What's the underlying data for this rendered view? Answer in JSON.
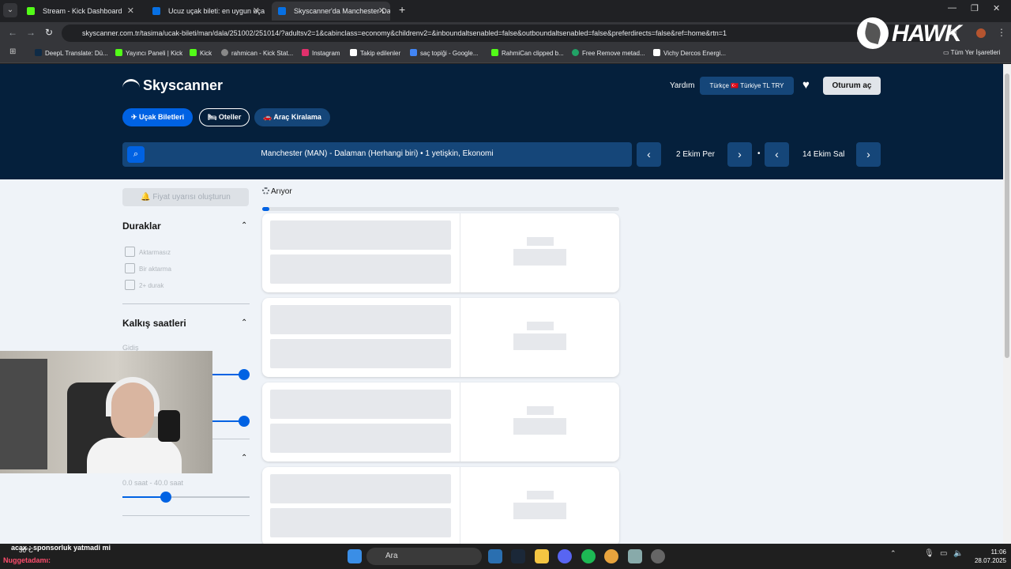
{
  "browser": {
    "tabs": [
      {
        "title": "Stream - Kick Dashboard",
        "icon": "kick-icon",
        "color": "#53fc18"
      },
      {
        "title": "Ucuz uçak bileti: en uygun uçak",
        "icon": "skyscanner-icon",
        "color": "#0770e3"
      },
      {
        "title": "Skyscanner'da Manchester-Dal",
        "icon": "skyscanner-icon",
        "color": "#0770e3"
      }
    ],
    "url": "skyscanner.com.tr/tasima/ucak-bileti/man/dala/251002/251014/?adultsv2=1&cabinclass=economy&childrenv2=&inboundaltsenabled=false&outboundaltsenabled=false&preferdirects=false&ref=home&rtn=1",
    "bookmarks": [
      {
        "label": "DeepL Translate: Dü...",
        "color": "#0f2b46"
      },
      {
        "label": "Yayıncı Paneli | Kick",
        "color": "#53fc18"
      },
      {
        "label": "Kick",
        "color": "#53fc18"
      },
      {
        "label": "rahmican - Kick Stat...",
        "color": "#888888"
      },
      {
        "label": "Instagram",
        "color": "#e1306c"
      },
      {
        "label": "Takip edilenler",
        "color": "#ffffff"
      },
      {
        "label": "saç topiği - Google...",
        "color": "#4285f4"
      },
      {
        "label": "RahmiCan clipped b...",
        "color": "#53fc18"
      },
      {
        "label": "Free Remove metad...",
        "color": "#21a366"
      },
      {
        "label": "Vichy Dercos Energi...",
        "color": "#ffffff"
      }
    ],
    "all_bookmarks": "Tüm Yer İşaretleri",
    "overlay_logo": "HAWK"
  },
  "header": {
    "logo": "Skyscanner",
    "help": "Yardım",
    "locale": "Türkçe  🇹🇷 Türkiye  TL TRY",
    "signin": "Oturum aç",
    "tabs": [
      {
        "label": "✈ Uçak Biletleri",
        "selected": true
      },
      {
        "label": "🛏 Oteller",
        "selected": false
      },
      {
        "label": "🚗 Araç Kiralama",
        "selected": false
      }
    ],
    "search_query": "Manchester (MAN) - Dalaman (Herhangi biri)  •  1 yetişkin, Ekonomi",
    "depart_date": "2 Ekim Per",
    "return_date": "14 Ekim Sal"
  },
  "main": {
    "price_alert": "🔔 Fiyat uyarısı oluşturun",
    "searching": "Arıyor",
    "progress": 0.02
  },
  "filters": {
    "stops_title": "Duraklar",
    "stops": [
      "Aktarmasız",
      "Bir aktarma",
      "2+ durak"
    ],
    "times_title": "Kalkış saatleri",
    "outbound_label": "Gidiş",
    "duration_label": "0.0 saat - 40.0 saat"
  },
  "stream": {
    "weather": "30°C",
    "chat_line": "acax : sponsorluk yatmadi mi",
    "chat_user": "Nuggetadamı:"
  },
  "taskbar": {
    "search": "Ara",
    "time": "11:06",
    "date": "28.07.2025"
  },
  "colors": {
    "header_bg": "#05203c",
    "accent": "#0062e3"
  }
}
